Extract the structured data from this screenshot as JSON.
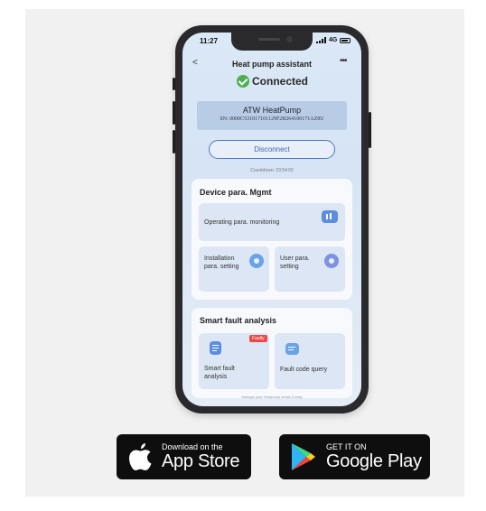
{
  "status_bar": {
    "time": "11:27",
    "network": "4G"
  },
  "nav": {
    "back": "<",
    "title": "Heat pump assistant",
    "more": "•••"
  },
  "connection": {
    "status": "Connected"
  },
  "device": {
    "name": "ATW HeatPump",
    "serial": "SN: 0000C531017101129F2B264100171AZ8U"
  },
  "disconnect_label": "Disconnect",
  "countdown": "Countdown: 23:54:02",
  "device_mgmt": {
    "title": "Device para. Mgmt",
    "operating": "Operating para. monitoring",
    "installation": "Installation para. setting",
    "user": "User para. setting"
  },
  "fault": {
    "title": "Smart fault analysis",
    "badge": "Faulty",
    "smart_label": "Smart fault analysis",
    "code_query": "Fault code query"
  },
  "home_hint": "Manage your Heatpump smart & easy",
  "stores": {
    "apple_small": "Download on the",
    "apple_big": "App Store",
    "google_small": "GET IT ON",
    "google_big": "Google Play"
  },
  "colors": {
    "accent": "#4a78c5",
    "connected_green": "#4caf50",
    "faulty_red": "#ec4848",
    "tile_bg": "#dce6f4"
  }
}
